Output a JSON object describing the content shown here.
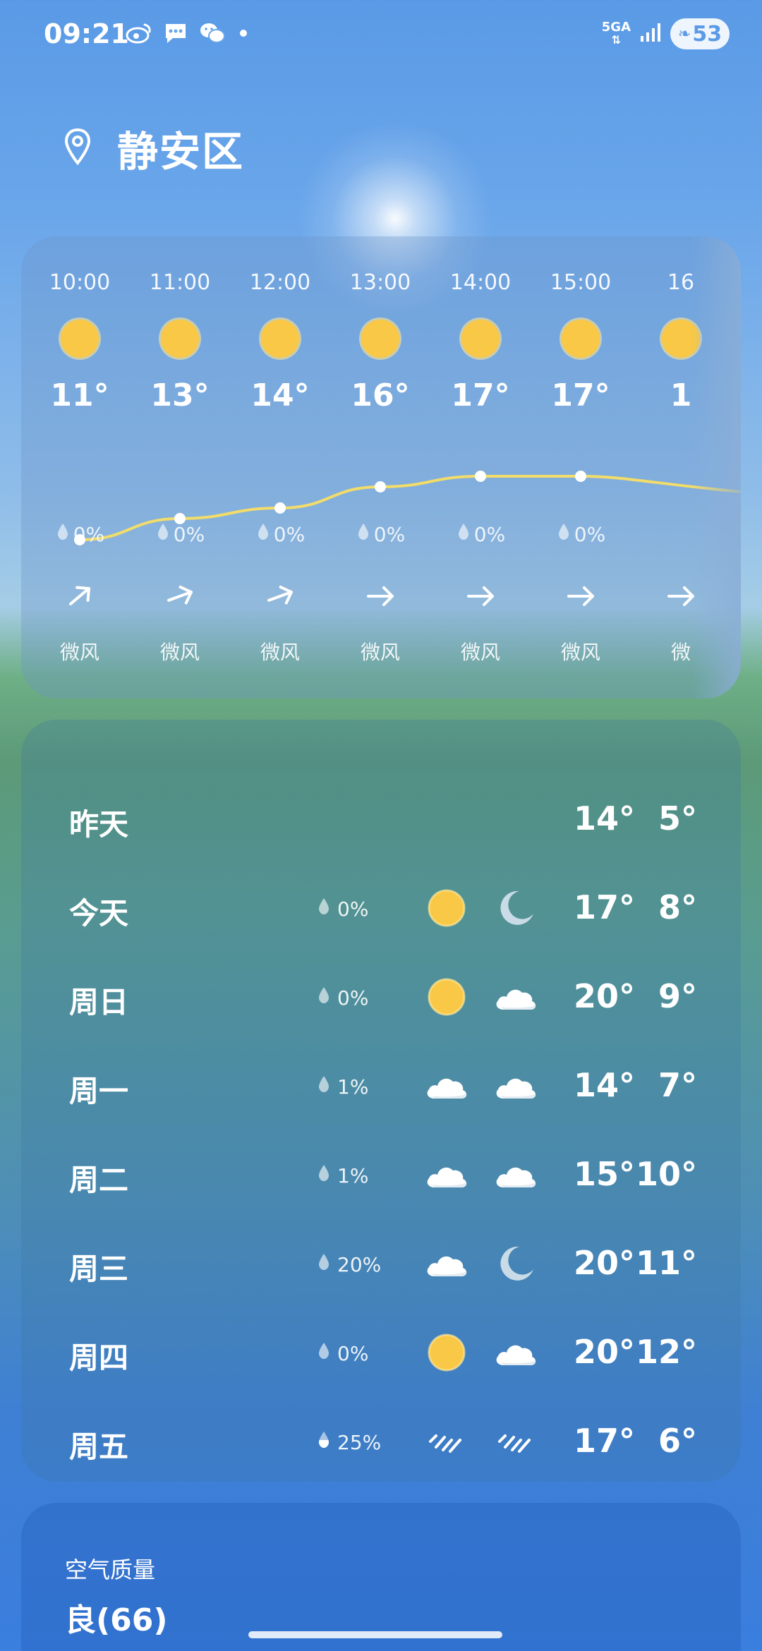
{
  "status_bar": {
    "time": "09:21",
    "network": "5GA",
    "battery": "53",
    "left_icons": [
      "weibo-icon",
      "message-icon",
      "wechat-icon"
    ]
  },
  "location": {
    "name": "静安区"
  },
  "hourly": [
    {
      "time": "10:00",
      "temp": "11°",
      "rain": "0%",
      "wind": "微风",
      "icon": "sun"
    },
    {
      "time": "11:00",
      "temp": "13°",
      "rain": "0%",
      "wind": "微风",
      "icon": "sun"
    },
    {
      "time": "12:00",
      "temp": "14°",
      "rain": "0%",
      "wind": "微风",
      "icon": "sun"
    },
    {
      "time": "13:00",
      "temp": "16°",
      "rain": "0%",
      "wind": "微风",
      "icon": "sun"
    },
    {
      "time": "14:00",
      "temp": "17°",
      "rain": "0%",
      "wind": "微风",
      "icon": "sun"
    },
    {
      "time": "15:00",
      "temp": "17°",
      "rain": "0%",
      "wind": "微风",
      "icon": "sun"
    },
    {
      "time": "16",
      "temp": "1",
      "rain": "",
      "wind": "微",
      "icon": "sun"
    }
  ],
  "daily": [
    {
      "day": "昨天",
      "rain": "",
      "day_icon": "",
      "night_icon": "",
      "high": "14°",
      "low": "5°"
    },
    {
      "day": "今天",
      "rain": "0%",
      "day_icon": "sun",
      "night_icon": "moon",
      "high": "17°",
      "low": "8°"
    },
    {
      "day": "周日",
      "rain": "0%",
      "day_icon": "sun",
      "night_icon": "cloud",
      "high": "20°",
      "low": "9°"
    },
    {
      "day": "周一",
      "rain": "1%",
      "day_icon": "cloud",
      "night_icon": "cloud",
      "high": "14°",
      "low": "7°"
    },
    {
      "day": "周二",
      "rain": "1%",
      "day_icon": "cloud",
      "night_icon": "cloud",
      "high": "15°",
      "low": "10°"
    },
    {
      "day": "周三",
      "rain": "20%",
      "day_icon": "cloud",
      "night_icon": "moon",
      "high": "20°",
      "low": "11°"
    },
    {
      "day": "周四",
      "rain": "0%",
      "day_icon": "sun",
      "night_icon": "cloud",
      "high": "20°",
      "low": "12°"
    },
    {
      "day": "周五",
      "rain": "25%",
      "day_icon": "rain",
      "night_icon": "rain",
      "high": "17°",
      "low": "6°"
    }
  ],
  "air_quality": {
    "label": "空气质量",
    "value": "良(66)"
  },
  "colors": {
    "sun": "#f9c846",
    "trend_line": "#f2dc6a"
  }
}
